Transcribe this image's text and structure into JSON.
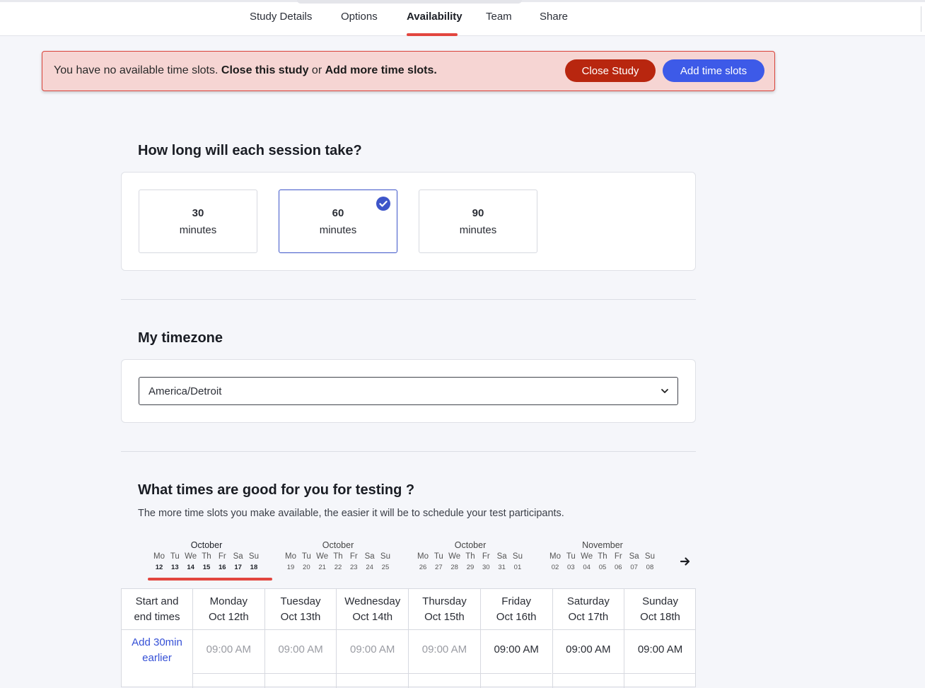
{
  "nav": {
    "tabs": [
      "Study Details",
      "Options",
      "Availability",
      "Team",
      "Share"
    ],
    "active_tab": "Availability"
  },
  "alert": {
    "text_1": "You have no available time slots. ",
    "bold_1": "Close this study",
    "text_2": " or ",
    "bold_2": "Add more time slots.",
    "close_label": "Close Study",
    "add_label": "Add time slots"
  },
  "duration": {
    "title": "How long will each session take?",
    "options": [
      {
        "value": "30",
        "unit": "minutes",
        "selected": false
      },
      {
        "value": "60",
        "unit": "minutes",
        "selected": true
      },
      {
        "value": "90",
        "unit": "minutes",
        "selected": false
      }
    ]
  },
  "timezone": {
    "title": "My timezone",
    "value": "America/Detroit"
  },
  "times": {
    "title": "What times are good for you for testing ?",
    "subtitle": "The more time slots you make available, the easier it will be to schedule your test participants.",
    "day_labels": [
      "Mo",
      "Tu",
      "We",
      "Th",
      "Fr",
      "Sa",
      "Su"
    ],
    "weeks": [
      {
        "month": "October",
        "days": [
          "12",
          "13",
          "14",
          "15",
          "16",
          "17",
          "18"
        ],
        "active": true
      },
      {
        "month": "October",
        "days": [
          "19",
          "20",
          "21",
          "22",
          "23",
          "24",
          "25"
        ],
        "active": false
      },
      {
        "month": "October",
        "days": [
          "26",
          "27",
          "28",
          "29",
          "30",
          "31",
          "01"
        ],
        "active": false
      },
      {
        "month": "November",
        "days": [
          "02",
          "03",
          "04",
          "05",
          "06",
          "07",
          "08"
        ],
        "active": false
      }
    ]
  },
  "table": {
    "first_header": [
      "Start and",
      "end times"
    ],
    "add_earlier": [
      "Add 30min",
      "earlier"
    ],
    "columns": [
      {
        "day": "Monday",
        "date": "Oct 12th",
        "time": "09:00 AM",
        "available": false
      },
      {
        "day": "Tuesday",
        "date": "Oct 13th",
        "time": "09:00 AM",
        "available": false
      },
      {
        "day": "Wednesday",
        "date": "Oct 14th",
        "time": "09:00 AM",
        "available": false
      },
      {
        "day": "Thursday",
        "date": "Oct 15th",
        "time": "09:00 AM",
        "available": false
      },
      {
        "day": "Friday",
        "date": "Oct 16th",
        "time": "09:00 AM",
        "available": true
      },
      {
        "day": "Saturday",
        "date": "Oct 17th",
        "time": "09:00 AM",
        "available": true
      },
      {
        "day": "Sunday",
        "date": "Oct 18th",
        "time": "09:00 AM",
        "available": true
      }
    ]
  },
  "colors": {
    "accent": "#e2463f",
    "primary": "#3d5ae8",
    "danger": "#b8260f",
    "alert_bg": "#f6d5d3"
  }
}
